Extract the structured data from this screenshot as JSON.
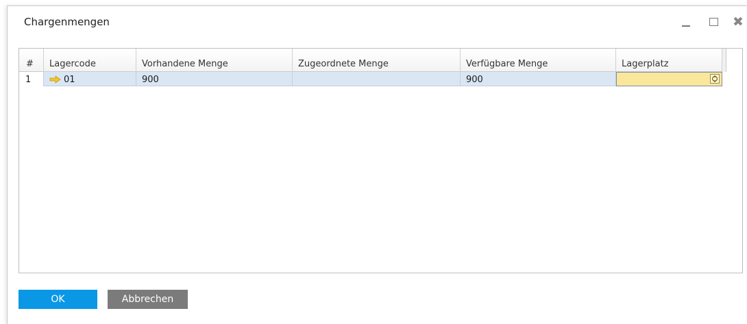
{
  "window": {
    "title": "Chargenmengen"
  },
  "table": {
    "columns": [
      {
        "label": "#"
      },
      {
        "label": "Lagercode"
      },
      {
        "label": "Vorhandene Menge"
      },
      {
        "label": "Zugeordnete Menge"
      },
      {
        "label": "Verfügbare Menge"
      },
      {
        "label": "Lagerplatz"
      }
    ],
    "rows": [
      {
        "num": "1",
        "lagercode": "01",
        "vorhandene_menge": "900",
        "zugeordnete_menge": "",
        "verfuegbare_menge": "900",
        "lagerplatz": ""
      }
    ]
  },
  "buttons": {
    "ok": "OK",
    "cancel": "Abbrechen"
  },
  "icons": {
    "link_arrow": "link-arrow-icon",
    "choose_from_list": "choose-from-list-icon"
  },
  "colors": {
    "primary_button": "#0a97e6",
    "secondary_button": "#7b7b7b",
    "selected_row": "#dae6f4",
    "active_cell": "#fbe79b",
    "link_arrow": "#f2c624"
  }
}
